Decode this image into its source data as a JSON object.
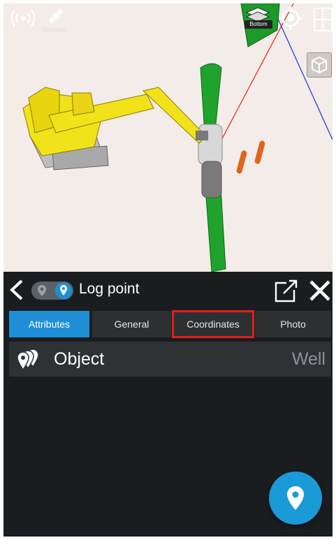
{
  "viewport": {
    "simulator_label": "Simulator",
    "layer_button_label": "Bottom",
    "icons": [
      "signal-broadcast-icon",
      "satellite-icon",
      "layers-icon",
      "locate-target-icon",
      "window-tile-icon",
      "cube-view-icon"
    ]
  },
  "panel": {
    "title": "Log point",
    "tabs": [
      {
        "label": "Attributes",
        "active": true
      },
      {
        "label": "General",
        "active": false
      },
      {
        "label": "Coordinates",
        "active": false,
        "highlighted": true
      },
      {
        "label": "Photo",
        "active": false
      }
    ],
    "row": {
      "label": "Object",
      "value": "Well",
      "icon": "stacked-pins-icon"
    }
  },
  "colors": {
    "accent": "#1e8fd6",
    "highlight_outline": "#e01e1e",
    "panel_background": "#1a1d20",
    "row_background": "#2f3235"
  },
  "fab": {
    "icon": "map-pin-icon"
  }
}
